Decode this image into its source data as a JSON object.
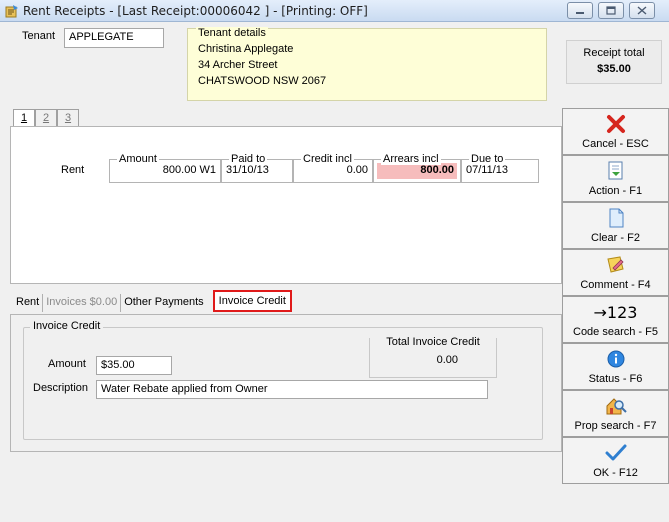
{
  "window": {
    "title": "Rent Receipts - [Last Receipt:00006042 ] - [Printing: OFF]"
  },
  "tenant": {
    "label": "Tenant",
    "value": "APPLEGATE",
    "details_legend": "Tenant details",
    "details_lines": [
      "Christina Applegate",
      "34 Archer Street",
      "CHATSWOOD  NSW  2067"
    ]
  },
  "receipt_total": {
    "label": "Receipt total",
    "value": "$35.00"
  },
  "number_tabs": [
    "1",
    "2",
    "3"
  ],
  "rent_row": {
    "label": "Rent",
    "columns": {
      "amount": {
        "header": "Amount",
        "value": "800.00 W1"
      },
      "paid_to": {
        "header": "Paid to",
        "value": "31/10/13"
      },
      "credit_incl": {
        "header": "Credit incl",
        "value": "0.00"
      },
      "arrears_incl": {
        "header": "Arrears incl",
        "value": "800.00"
      },
      "due_to": {
        "header": "Due to",
        "value": "07/11/13"
      }
    },
    "arrears_color": "#f6bcbc"
  },
  "bottom_tabs": {
    "rent": "Rent",
    "invoices": "Invoices $0.00",
    "other_payments": "Other Payments",
    "invoice_credit": "Invoice Credit",
    "highlight_color": "#e01a1a"
  },
  "invoice_credit": {
    "legend": "Invoice Credit",
    "amount_label": "Amount",
    "amount_value": "$35.00",
    "description_label": "Description",
    "description_value": "Water Rebate applied from Owner",
    "total_label": "Total Invoice Credit",
    "total_value": "0.00"
  },
  "sidebar": {
    "cancel": {
      "label": "Cancel - ESC",
      "icon": "red-x-icon"
    },
    "action": {
      "label": "Action - F1",
      "icon": "document-green-arrow-icon"
    },
    "clear": {
      "label": "Clear - F2",
      "icon": "blank-page-icon"
    },
    "comment": {
      "label": "Comment - F4",
      "icon": "note-pencil-icon"
    },
    "code_search": {
      "label": "Code search - F5",
      "glyph": "→123",
      "icon": "arrow-123-icon"
    },
    "status": {
      "label": "Status - F6",
      "icon": "info-icon"
    },
    "prop_search": {
      "label": "Prop search - F7",
      "icon": "house-magnifier-icon"
    },
    "ok": {
      "label": "OK - F12",
      "icon": "checkmark-icon"
    }
  }
}
